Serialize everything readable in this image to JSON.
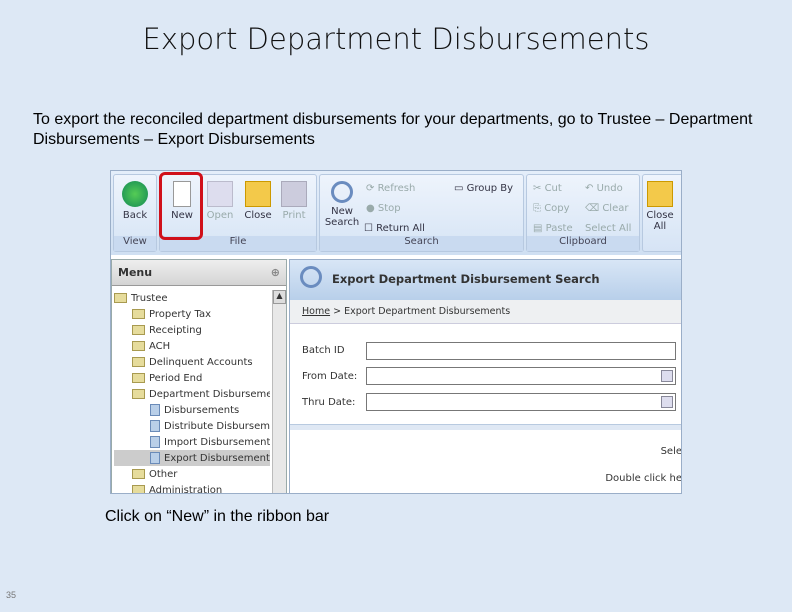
{
  "slide": {
    "title": "Export Department Disbursements",
    "intro": "To export the reconciled department disbursements for your departments, go to Trustee – Department Disbursements – Export Disbursements",
    "caption": "Click on “New” in the ribbon bar",
    "page_number": "35"
  },
  "ribbon": {
    "groups": {
      "view": "View",
      "file": "File",
      "search": "Search",
      "clipboard": "Clipboard"
    },
    "buttons": {
      "back": "Back",
      "new": "New",
      "open": "Open",
      "close": "Close",
      "print": "Print",
      "new_search": "New Search",
      "refresh": "Refresh",
      "stop": "Stop",
      "return_all": "Return All",
      "group_by": "Group By",
      "cut": "Cut",
      "undo": "Undo",
      "copy": "Copy",
      "clear": "Clear",
      "paste": "Paste",
      "select_all": "Select All",
      "close_all": "Close All"
    },
    "highlight_color": "#d0101a"
  },
  "menu": {
    "title": "Menu",
    "items": [
      {
        "label": "Trustee",
        "type": "folder",
        "level": 0
      },
      {
        "label": "Property Tax",
        "type": "folder",
        "level": 1
      },
      {
        "label": "Receipting",
        "type": "folder",
        "level": 1
      },
      {
        "label": "ACH",
        "type": "folder",
        "level": 1
      },
      {
        "label": "Delinquent Accounts",
        "type": "folder",
        "level": 1
      },
      {
        "label": "Period End",
        "type": "folder",
        "level": 1
      },
      {
        "label": "Department Disbursements",
        "type": "folder",
        "level": 1
      },
      {
        "label": "Disbursements",
        "type": "doc",
        "level": 2
      },
      {
        "label": "Distribute Disbursements",
        "type": "doc",
        "level": 2
      },
      {
        "label": "Import Disbursements",
        "type": "doc",
        "level": 2
      },
      {
        "label": "Export Disbursements",
        "type": "doc",
        "level": 2,
        "selected": true
      },
      {
        "label": "Other",
        "type": "folder",
        "level": 1
      },
      {
        "label": "Administration",
        "type": "folder",
        "level": 1
      }
    ]
  },
  "main": {
    "title": "Export Department Disbursement Search",
    "breadcrumb": {
      "home": "Home",
      "sep": ">",
      "current": "Export Department Disbursements"
    },
    "fields": {
      "batch_id": {
        "label": "Batch ID",
        "value": ""
      },
      "from_date": {
        "label": "From Date:",
        "value": ""
      },
      "thru_date": {
        "label": "Thru Date:",
        "value": ""
      }
    },
    "hint1": "Sele",
    "hint2": "Double click he"
  }
}
